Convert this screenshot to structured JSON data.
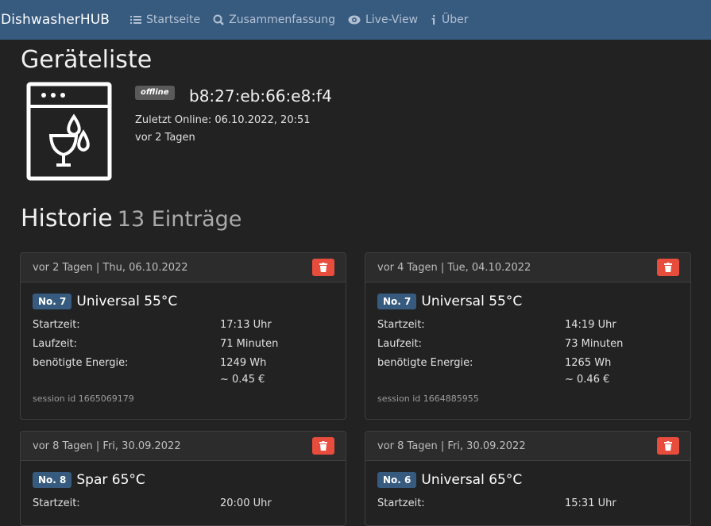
{
  "nav": {
    "brand": "DishwasherHUB",
    "items": [
      {
        "label": "Startseite",
        "icon": "list-icon"
      },
      {
        "label": "Zusammenfassung",
        "icon": "search-icon"
      },
      {
        "label": "Live-View",
        "icon": "eye-icon"
      },
      {
        "label": "Über",
        "icon": "info-icon"
      }
    ]
  },
  "device_section": {
    "title": "Geräteliste",
    "status_badge": "offline",
    "mac": "b8:27:eb:66:e8:f4",
    "last_online": "Zuletzt Online: 06.10.2022, 20:51",
    "ago": "vor 2 Tagen"
  },
  "history": {
    "title": "Historie",
    "count": "13 Einträge",
    "cards": [
      {
        "header": "vor 2 Tagen | Thu, 06.10.2022",
        "no": "No. 7",
        "program": "Universal 55°C",
        "start_label": "Startzeit:",
        "start": "17:13 Uhr",
        "run_label": "Laufzeit:",
        "run": "71 Minuten",
        "energy_label": "benötigte Energie:",
        "energy": "1249 Wh",
        "cost": "~ 0.45 €",
        "session": "session id 1665069179"
      },
      {
        "header": "vor 4 Tagen | Tue, 04.10.2022",
        "no": "No. 7",
        "program": "Universal 55°C",
        "start_label": "Startzeit:",
        "start": "14:19 Uhr",
        "run_label": "Laufzeit:",
        "run": "73 Minuten",
        "energy_label": "benötigte Energie:",
        "energy": "1265 Wh",
        "cost": "~ 0.46 €",
        "session": "session id 1664885955"
      },
      {
        "header": "vor 8 Tagen | Fri, 30.09.2022",
        "no": "No. 8",
        "program": "Spar 65°C",
        "start_label": "Startzeit:",
        "start": "20:00 Uhr"
      },
      {
        "header": "vor 8 Tagen | Fri, 30.09.2022",
        "no": "No. 6",
        "program": "Universal 65°C",
        "start_label": "Startzeit:",
        "start": "15:31 Uhr"
      }
    ]
  },
  "colors": {
    "navbar": "#375a7f",
    "background": "#222222",
    "delete": "#e74c3c",
    "badge": "#375a7f"
  }
}
